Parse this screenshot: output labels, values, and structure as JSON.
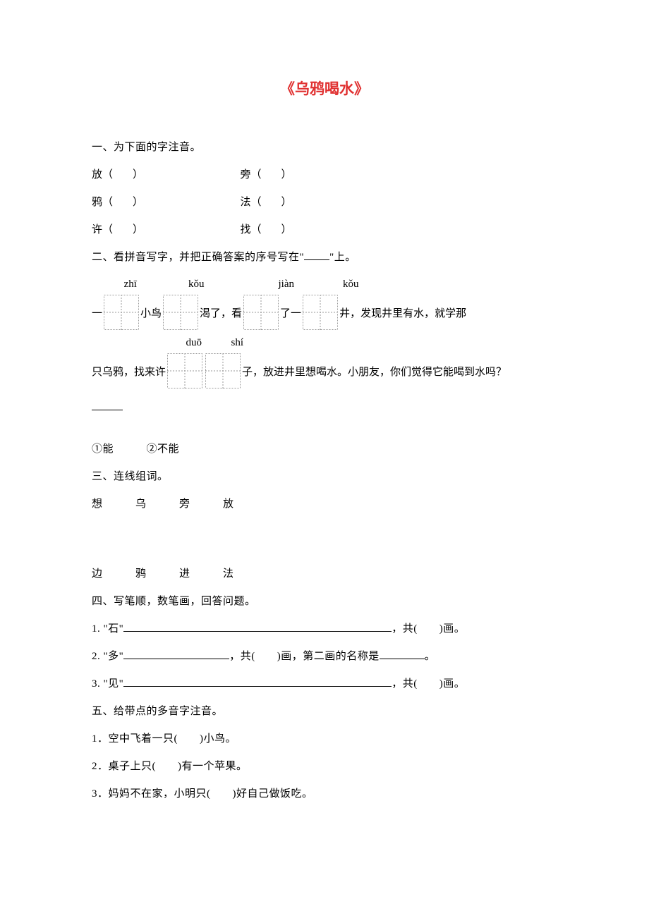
{
  "title": "《乌鸦喝水》",
  "section1": {
    "heading": "一、为下面的字注音。",
    "rows": [
      {
        "a": "放（",
        "b": "）",
        "c": "旁（",
        "d": "）"
      },
      {
        "a": "鸦（",
        "b": "）",
        "c": "法（",
        "d": "）"
      },
      {
        "a": "许（",
        "b": "）",
        "c": "找（",
        "d": "）"
      }
    ]
  },
  "section2": {
    "heading_prefix": "二、看拼音写字，并把正确答案的序号写在\"",
    "heading_suffix": "\"上。",
    "pinyin_top": {
      "zhi": "zhī",
      "kou1": "kǒu",
      "jian": "jiàn",
      "kou2": "kǒu"
    },
    "line1": {
      "a": "一",
      "b": "小鸟",
      "c": "渴了，看",
      "d": "了一",
      "e": "井，发现井里有水，就学那"
    },
    "pinyin_mid": {
      "duo": "duō",
      "shi": "shí"
    },
    "line2": {
      "a": "只乌鸦，找来许",
      "b": "子，放进井里想喝水。小朋友，你们觉得它能喝到水吗？"
    },
    "options": "①能　　　②不能"
  },
  "section3": {
    "heading": "三、连线组词。",
    "row1": "想　　　乌　　　旁　　　放",
    "row2": "边　　　鸦　　　进　　　法"
  },
  "section4": {
    "heading": "四、写笔顺，数笔画，回答问题。",
    "q1a": "1. \"石\"",
    "q1b": "，共(　　)画。",
    "q2a": "2. \"多\"",
    "q2b": "，共(　　)画，第二画的名称是",
    "q2c": "。",
    "q3a": "3. \"见\"",
    "q3b": "，共(　　)画。"
  },
  "section5": {
    "heading": "五、给带点的多音字注音。",
    "q1": "1．空中飞着一只(　　)小鸟。",
    "q2": "2．桌子上只(　　)有一个苹果。",
    "q3": "3．妈妈不在家，小明只(　　)好自己做饭吃。"
  }
}
